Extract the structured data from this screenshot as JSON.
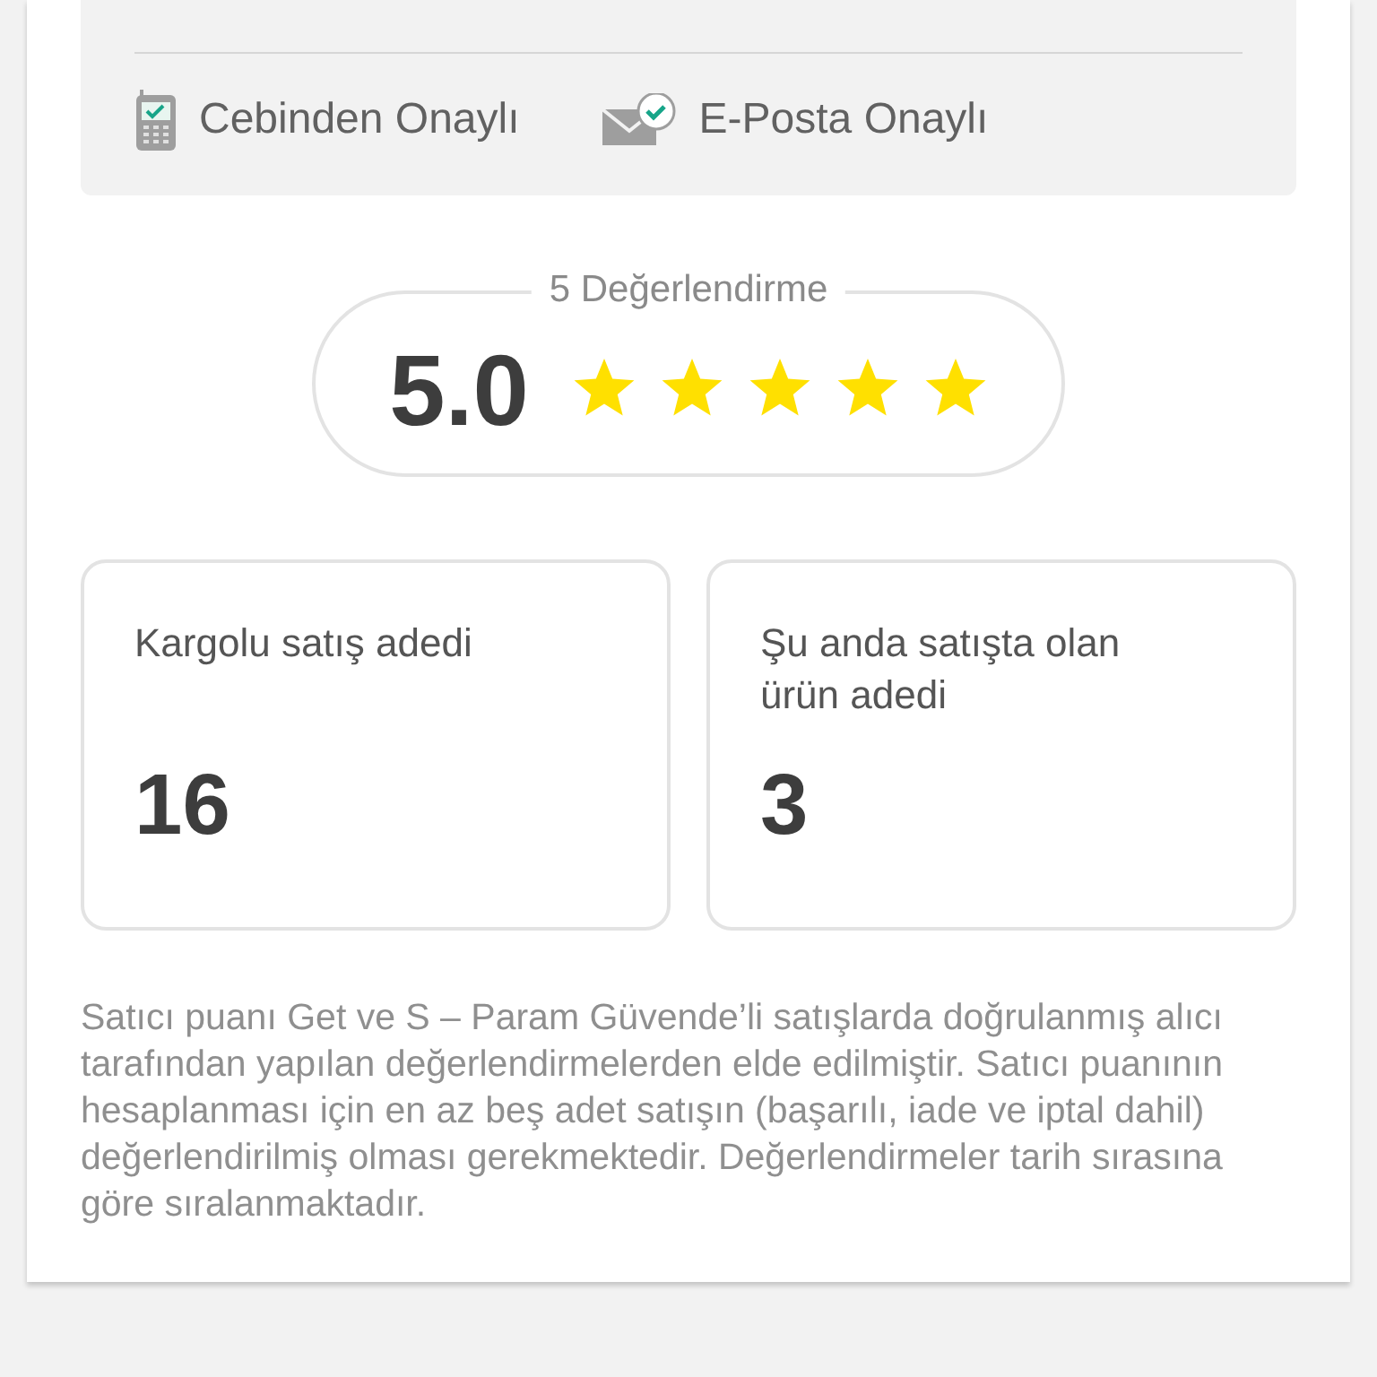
{
  "verifications": [
    {
      "kind": "phone",
      "label": "Cebinden Onaylı"
    },
    {
      "kind": "email",
      "label": "E-Posta Onaylı"
    }
  ],
  "rating": {
    "count_label": "5 Değerlendirme",
    "score": "5.0",
    "stars": 5
  },
  "stats": [
    {
      "label": "Kargolu satış adedi",
      "value": "16"
    },
    {
      "label": "Şu anda satışta olan ürün adedi",
      "value": "3"
    }
  ],
  "note": "Satıcı puanı Get ve S – Param Güvende’li satışlarda doğrulanmış alıcı tarafından yapılan değerlendirmelerden elde edilmiştir. Satıcı puanının hesaplanması için en az beş adet satışın (başarılı, iade ve iptal dahil) değerlendirilmiş olması gerekmektedir. Değerlendirmeler tarih sırasına göre sıralanmaktadır."
}
